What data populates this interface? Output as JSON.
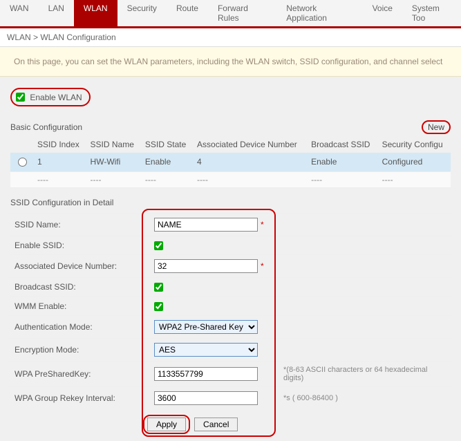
{
  "nav": {
    "items": [
      "WAN",
      "LAN",
      "WLAN",
      "Security",
      "Route",
      "Forward Rules",
      "Network Application",
      "Voice",
      "System Too"
    ],
    "active_index": 2
  },
  "breadcrumb": "WLAN > WLAN Configuration",
  "notice": "On this page, you can set the WLAN parameters, including the WLAN switch, SSID configuration, and channel select",
  "enable_wlan": {
    "label": "Enable WLAN",
    "checked": true
  },
  "basic": {
    "title": "Basic Configuration",
    "new_label": "New",
    "columns": [
      "SSID Index",
      "SSID Name",
      "SSID State",
      "Associated Device Number",
      "Broadcast SSID",
      "Security Configu"
    ],
    "rows": [
      {
        "index": "1",
        "name": "HW-Wifi",
        "state": "Enable",
        "assoc": "4",
        "broadcast": "Enable",
        "security": "Configured"
      },
      {
        "index": "----",
        "name": "----",
        "state": "----",
        "assoc": "----",
        "broadcast": "----",
        "security": "----"
      }
    ]
  },
  "detail": {
    "title": "SSID Configuration in Detail",
    "labels": {
      "ssid_name": "SSID Name:",
      "enable_ssid": "Enable SSID:",
      "assoc_num": "Associated Device Number:",
      "broadcast": "Broadcast SSID:",
      "wmm": "WMM Enable:",
      "auth_mode": "Authentication Mode:",
      "enc_mode": "Encryption Mode:",
      "psk": "WPA PreSharedKey:",
      "rekey": "WPA Group Rekey Interval:"
    },
    "values": {
      "ssid_name": "NAME",
      "enable_ssid": true,
      "assoc_num": "32",
      "broadcast": true,
      "wmm": true,
      "auth_mode": "WPA2 Pre-Shared Key",
      "enc_mode": "AES",
      "psk": "1133557799",
      "rekey": "3600"
    },
    "hints": {
      "psk": "*(8-63 ASCII characters or 64 hexadecimal digits)",
      "rekey": "*s ( 600-86400 )"
    },
    "buttons": {
      "apply": "Apply",
      "cancel": "Cancel"
    }
  }
}
